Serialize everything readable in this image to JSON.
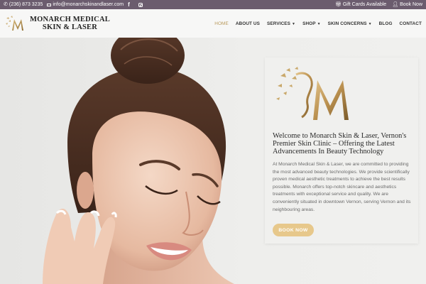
{
  "topbar": {
    "phone": "(236) 873 3235",
    "email": "info@monarchskinandlaser.com",
    "facebook_icon": "facebook-icon",
    "instagram_icon": "instagram-icon",
    "gift_cards": "Gift Cards Available",
    "book_now": "Book Now"
  },
  "header": {
    "logo_line1": "MONARCH MEDICAL",
    "logo_line2": "SKIN & LASER",
    "nav": [
      {
        "label": "HOME",
        "active": true
      },
      {
        "label": "ABOUT US"
      },
      {
        "label": "SERVICES",
        "dropdown": true
      },
      {
        "label": "SHOP",
        "dropdown": true
      },
      {
        "label": "SKIN CONCERNS",
        "dropdown": true
      },
      {
        "label": "BLOG"
      },
      {
        "label": "CONTACT"
      }
    ]
  },
  "card": {
    "title": "Welcome to Monarch Skin & Laser, Vernon's Premier Skin Clinic – Offering the Latest Advancements In Beauty Technology",
    "body": "At Monarch Medical Skin & Laser, we are committed to providing the most advanced beauty technologies. We provide scientifically proven medical aesthetic treatments to achieve the best results possible. Monarch offers top-notch skincare and aesthetics treatments with exceptional service and quality. We are conveniently situated in downtown Vernon, serving Vernon and its neighbouring areas.",
    "button": "BOOK NOW"
  },
  "colors": {
    "topbar": "#6b5c6e",
    "gold": "#b99a5c",
    "button": "#e7c88b"
  }
}
